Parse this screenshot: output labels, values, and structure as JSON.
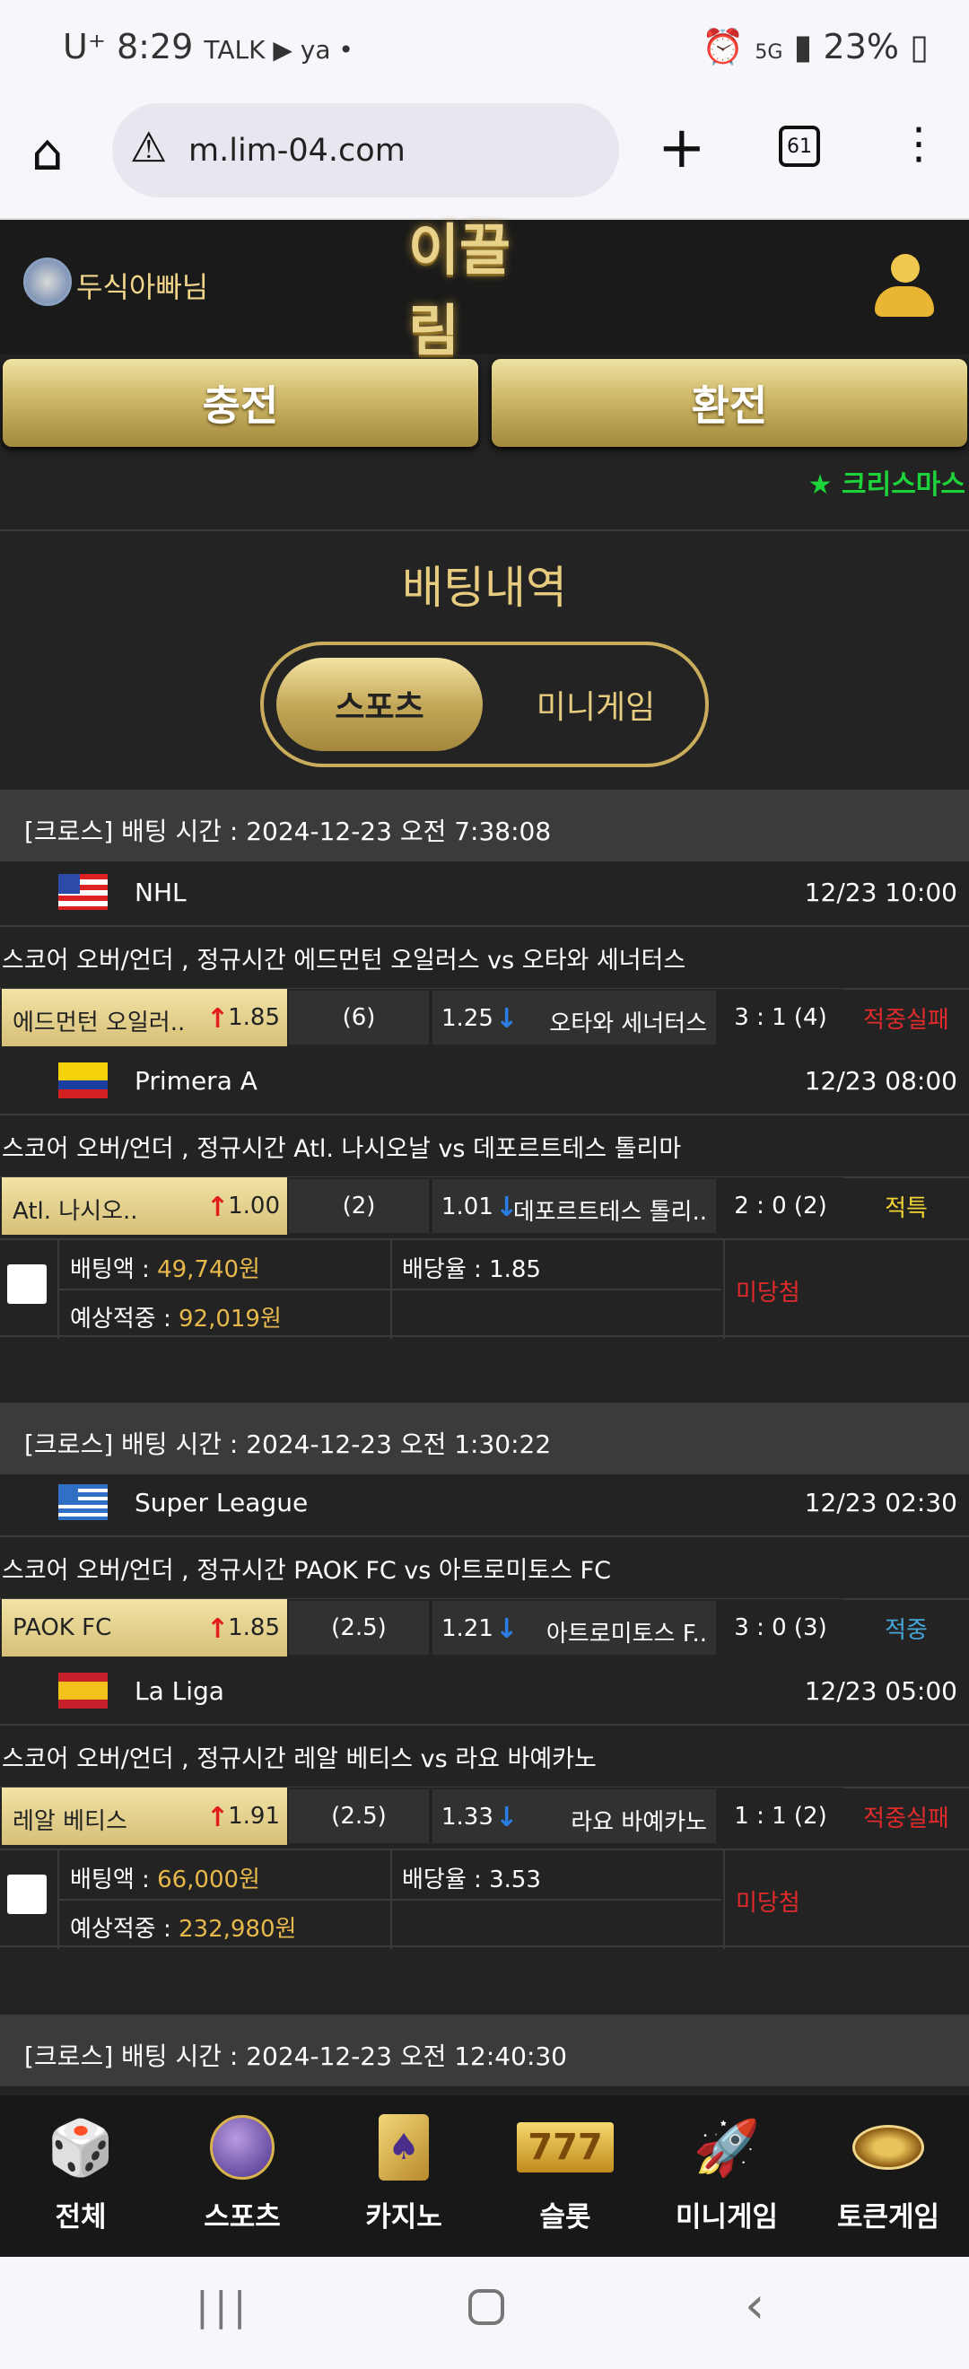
{
  "status": {
    "carrier": "U⁺",
    "time": "8:29",
    "icons_left": "TALK ▶ ya •",
    "battery": "23%"
  },
  "browser": {
    "url": "m.lim-04.com",
    "tab_count": "61"
  },
  "header": {
    "logo": "이끌림",
    "username": "두식아빠님"
  },
  "buttons": {
    "deposit": "충전",
    "withdraw": "환전"
  },
  "event_link": "★ 크리스마스",
  "page_title": "배팅내역",
  "tabs": {
    "sports": "스포츠",
    "mini": "미니게임"
  },
  "labels": {
    "bet_amount": "배팅액 : ",
    "odds": "배당율 : ",
    "expected": "예상적중 : "
  },
  "bets": [
    {
      "header": "[크로스] 배팅 시간 : 2024-12-23 오전 7:38:08",
      "games": [
        {
          "league": "NHL",
          "date": "12/23 10:00",
          "market": "스코어 오버/언더 , 정규시간 에드먼턴 오일러스  vs  오타와 세너터스",
          "home": "에드먼턴 오일러..",
          "home_odds": "1.85",
          "line": "(6)",
          "away_odds": "1.25",
          "away": "오타와 세너터스",
          "score": "3 : 1 (4)",
          "result": "적중실패",
          "result_color": "#e12b2b"
        },
        {
          "league": "Primera A",
          "date": "12/23 08:00",
          "market": "스코어 오버/언더 , 정규시간 Atl. 나시오날  vs  데포르트테스 톨리마",
          "home": "Atl. 나시오..",
          "home_odds": "1.00",
          "line": "(2)",
          "away_odds": "1.01",
          "away": "데포르트테스 톨리..",
          "score": "2 : 0 (2)",
          "result": "적특",
          "result_color": "#f1d334"
        }
      ],
      "bet_amount": "49,740원",
      "odds": "1.85",
      "expected": "92,019원",
      "status": "미당첨"
    },
    {
      "header": "[크로스] 배팅 시간 : 2024-12-23 오전 1:30:22",
      "games": [
        {
          "league": "Super League",
          "date": "12/23 02:30",
          "market": "스코어 오버/언더 , 정규시간 PAOK FC  vs  아트로미토스 FC",
          "home": "PAOK FC",
          "home_odds": "1.85",
          "line": "(2.5)",
          "away_odds": "1.21",
          "away": "아트로미토스 F..",
          "score": "3 : 0 (3)",
          "result": "적중",
          "result_color": "#46a6d9"
        },
        {
          "league": "La Liga",
          "date": "12/23 05:00",
          "market": "스코어 오버/언더 , 정규시간 레알 베티스  vs  라요 바예카노",
          "home": "레알 베티스",
          "home_odds": "1.91",
          "line": "(2.5)",
          "away_odds": "1.33",
          "away": "라요 바예카노",
          "score": "1 : 1 (2)",
          "result": "적중실패",
          "result_color": "#e12b2b"
        }
      ],
      "bet_amount": "66,000원",
      "odds": "3.53",
      "expected": "232,980원",
      "status": "미당첨"
    }
  ],
  "third_bet_header": "[크로스] 배팅 시간 : 2024-12-23 오전 12:40:30",
  "nav": [
    {
      "label": "전체",
      "icon": "dice-icon"
    },
    {
      "label": "스포츠",
      "icon": "ball-icon"
    },
    {
      "label": "카지노",
      "icon": "cards-icon"
    },
    {
      "label": "슬롯",
      "icon": "slot-icon"
    },
    {
      "label": "미니게임",
      "icon": "rocket-icon"
    },
    {
      "label": "토큰게임",
      "icon": "roulette-icon"
    }
  ],
  "colors": {
    "gold": "#e7cc7f",
    "loss": "#e12b2b",
    "win": "#46a6d9",
    "void": "#f1d334",
    "xmas": "#1ed23a"
  }
}
